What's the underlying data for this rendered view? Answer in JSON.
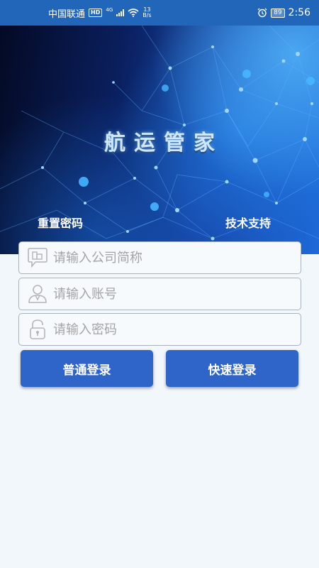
{
  "status_bar": {
    "carrier": "中国联通",
    "hd": "HD",
    "network": "4G",
    "speed_value": "13",
    "speed_unit": "B/s",
    "battery": "89",
    "time": "2:56",
    "icons": [
      "signal-icon",
      "wifi-icon",
      "alarm-icon",
      "battery-icon"
    ]
  },
  "hero": {
    "title": "航运管家",
    "reset_password": "重置密码",
    "tech_support": "技术支持"
  },
  "form": {
    "company_placeholder": "请输入公司简称",
    "company_value": "",
    "account_placeholder": "请输入账号",
    "account_value": "",
    "password_placeholder": "请输入密码",
    "password_value": "",
    "icons": [
      "company-icon",
      "user-icon",
      "lock-icon"
    ]
  },
  "buttons": {
    "normal_login": "普通登录",
    "quick_login": "快速登录"
  },
  "colors": {
    "status_bar": "#2166b9",
    "button": "#2f65c8",
    "background": "#f1f7fb"
  }
}
